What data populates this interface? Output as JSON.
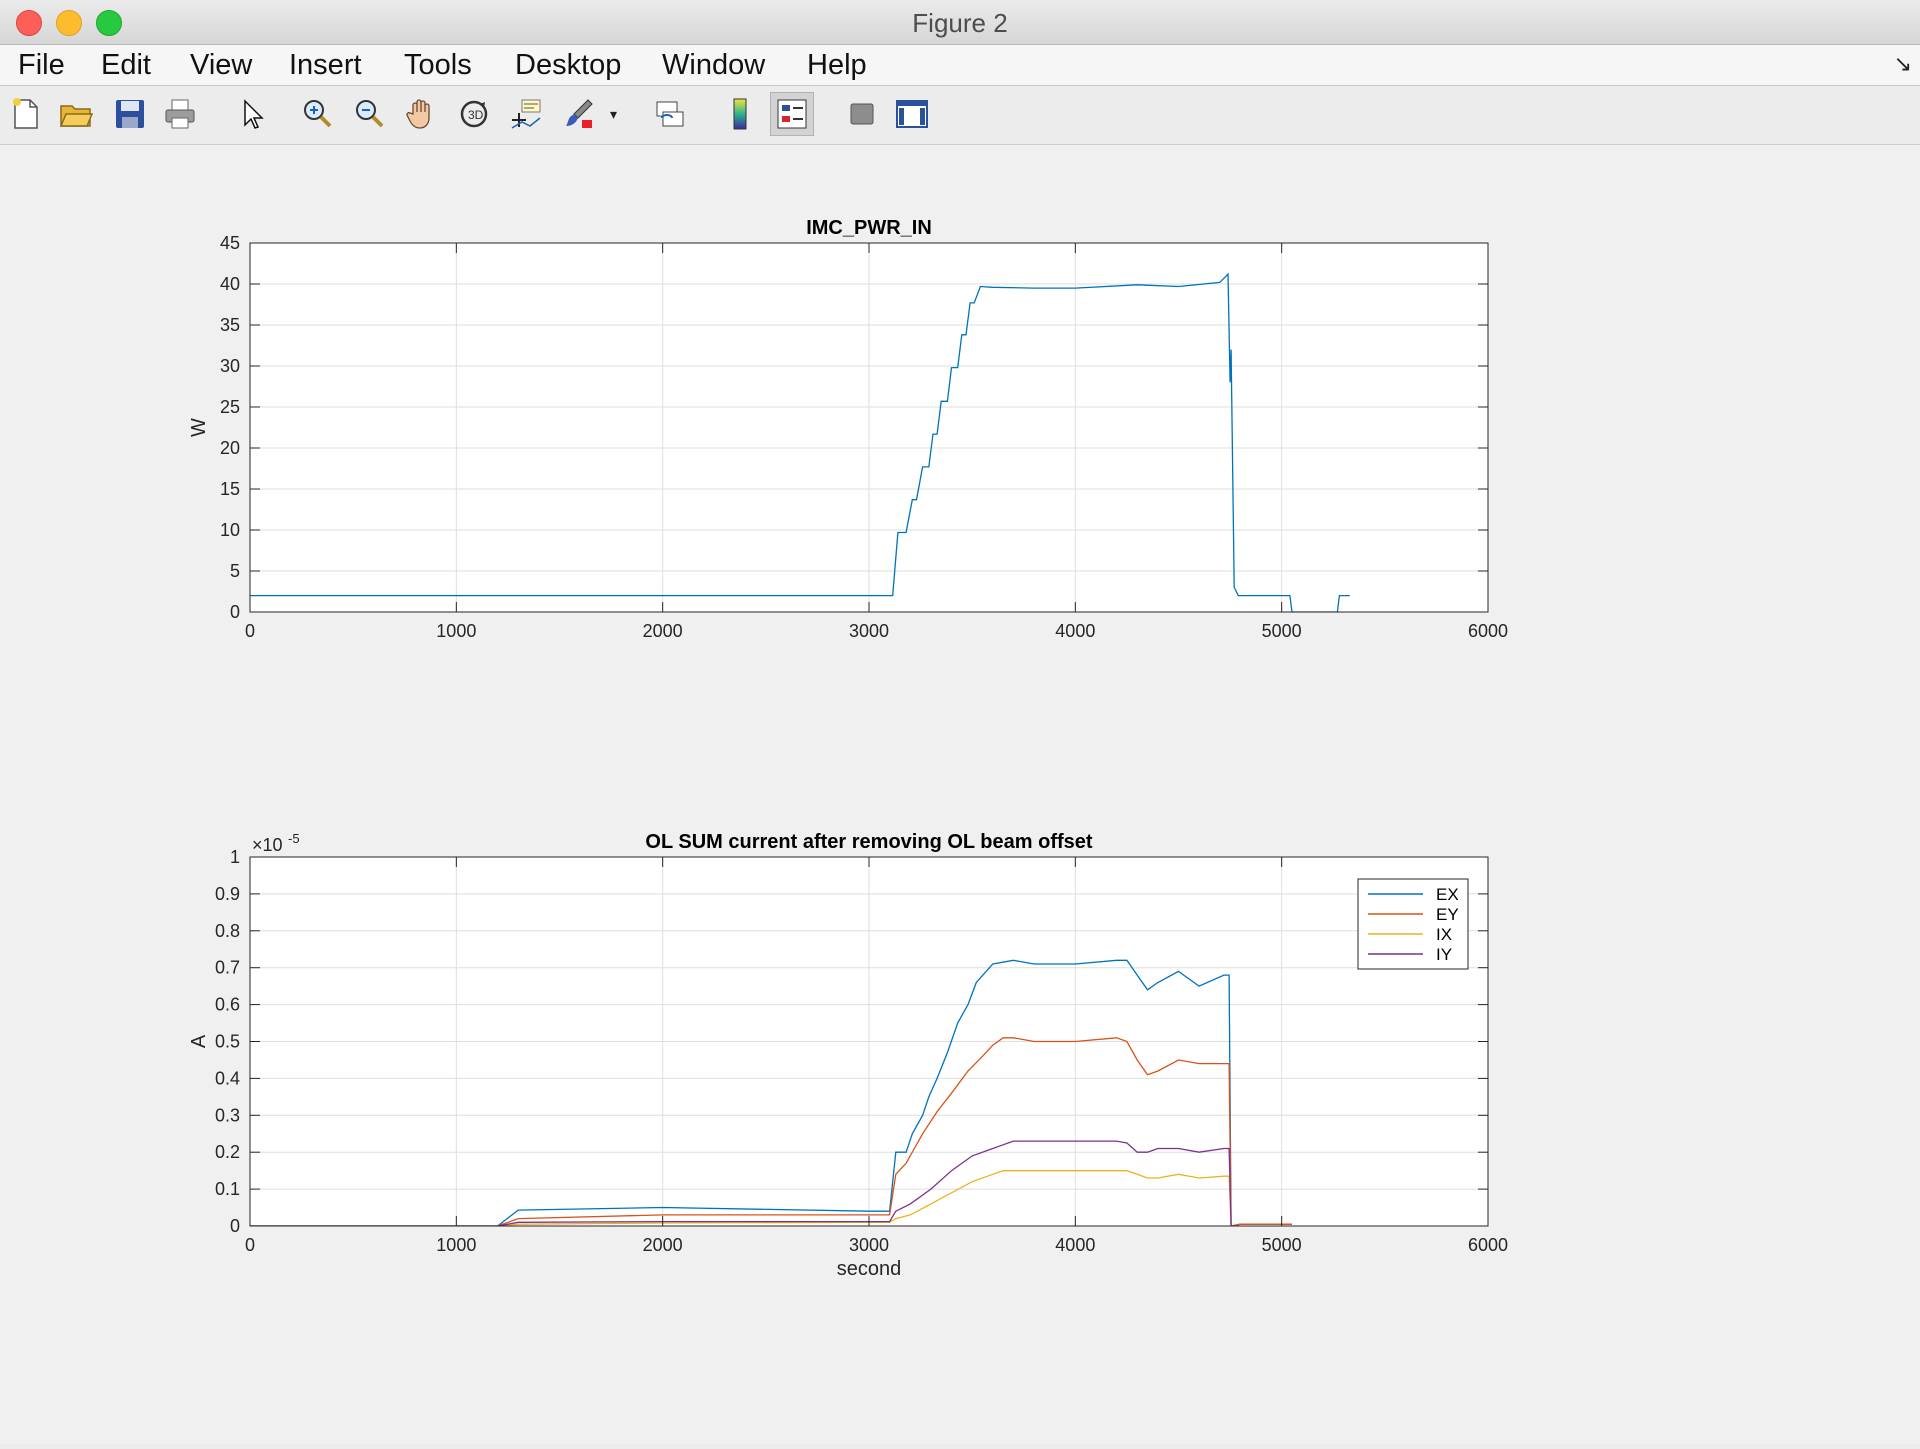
{
  "window": {
    "title": "Figure 2"
  },
  "menu": [
    "File",
    "Edit",
    "View",
    "Insert",
    "Tools",
    "Desktop",
    "Window",
    "Help"
  ],
  "toolbar_icons": [
    "new-figure-icon",
    "open-file-icon",
    "save-icon",
    "print-icon",
    "select-arrow-icon",
    "zoom-in-icon",
    "zoom-out-icon",
    "pan-hand-icon",
    "rotate-3d-icon",
    "data-cursor-icon",
    "brush-icon",
    "link-plot-icon",
    "colorbar-icon",
    "legend-icon",
    "hide-plot-tools-icon",
    "show-plot-tools-icon"
  ],
  "chart_data": [
    {
      "type": "line",
      "title": "IMC_PWR_IN",
      "xlabel": "",
      "ylabel": "W",
      "xlim": [
        0,
        6000
      ],
      "ylim": [
        0,
        45
      ],
      "xticks": [
        0,
        1000,
        2000,
        3000,
        4000,
        5000,
        6000
      ],
      "yticks": [
        0,
        5,
        10,
        15,
        20,
        25,
        30,
        35,
        40,
        45
      ],
      "grid": true,
      "series": [
        {
          "color": "#0072bd",
          "x": [
            0,
            3100,
            3115,
            3140,
            3180,
            3210,
            3230,
            3260,
            3290,
            3310,
            3330,
            3350,
            3380,
            3400,
            3430,
            3450,
            3470,
            3490,
            3510,
            3540,
            3600,
            3800,
            4000,
            4300,
            4500,
            4700,
            4740,
            4750,
            4755,
            4770,
            4790,
            4800,
            5040,
            5050,
            5270,
            5280,
            5330
          ],
          "y": [
            2,
            2,
            2,
            9.7,
            9.7,
            13.7,
            13.7,
            17.7,
            17.7,
            21.7,
            21.7,
            25.7,
            25.7,
            29.8,
            29.8,
            33.8,
            33.8,
            37.7,
            37.7,
            39.7,
            39.6,
            39.5,
            39.5,
            39.9,
            39.7,
            40.2,
            41.2,
            28,
            32,
            3,
            2,
            2,
            2,
            0,
            0,
            2,
            2
          ]
        }
      ]
    },
    {
      "type": "line",
      "title": "OL SUM current after removing OL beam offset",
      "xlabel": "second",
      "ylabel": "A",
      "exponent_label": "×10",
      "exponent_power": "-5",
      "xlim": [
        0,
        6000
      ],
      "ylim": [
        0,
        1
      ],
      "xticks": [
        0,
        1000,
        2000,
        3000,
        4000,
        5000,
        6000
      ],
      "yticks": [
        0,
        0.1,
        0.2,
        0.3,
        0.4,
        0.5,
        0.6,
        0.7,
        0.8,
        0.9,
        1
      ],
      "grid": true,
      "legend": {
        "position": "top-right"
      },
      "series": [
        {
          "name": "EX",
          "color": "#0072bd",
          "x": [
            0,
            1200,
            1300,
            2000,
            3000,
            3100,
            3130,
            3180,
            3210,
            3260,
            3290,
            3330,
            3380,
            3430,
            3480,
            3520,
            3600,
            3700,
            3800,
            4000,
            4200,
            4250,
            4300,
            4350,
            4400,
            4500,
            4600,
            4720,
            4745,
            4755,
            4800,
            5050
          ],
          "y": [
            0,
            0,
            0.043,
            0.05,
            0.04,
            0.04,
            0.2,
            0.2,
            0.25,
            0.3,
            0.35,
            0.4,
            0.47,
            0.55,
            0.6,
            0.66,
            0.71,
            0.72,
            0.71,
            0.71,
            0.72,
            0.72,
            0.68,
            0.64,
            0.66,
            0.69,
            0.65,
            0.68,
            0.68,
            0,
            0.005,
            0.005
          ]
        },
        {
          "name": "EY",
          "color": "#d95319",
          "x": [
            0,
            1200,
            1300,
            2000,
            3000,
            3100,
            3130,
            3180,
            3260,
            3330,
            3400,
            3480,
            3550,
            3600,
            3650,
            3700,
            3800,
            4000,
            4200,
            4250,
            4300,
            4350,
            4400,
            4500,
            4600,
            4720,
            4745,
            4755,
            4800,
            5050
          ],
          "y": [
            0,
            0,
            0.02,
            0.03,
            0.03,
            0.03,
            0.14,
            0.17,
            0.25,
            0.31,
            0.36,
            0.42,
            0.46,
            0.49,
            0.51,
            0.51,
            0.5,
            0.5,
            0.51,
            0.5,
            0.45,
            0.41,
            0.42,
            0.45,
            0.44,
            0.44,
            0.44,
            0,
            0.005,
            0.005
          ]
        },
        {
          "name": "IX",
          "color": "#edb120",
          "x": [
            0,
            1200,
            1300,
            2000,
            3000,
            3100,
            3130,
            3200,
            3300,
            3400,
            3500,
            3600,
            3650,
            3700,
            3800,
            4000,
            4200,
            4250,
            4300,
            4350,
            4400,
            4500,
            4600,
            4720,
            4745,
            4755
          ],
          "y": [
            0,
            0,
            0.005,
            0.008,
            0.01,
            0.01,
            0.02,
            0.03,
            0.06,
            0.09,
            0.12,
            0.14,
            0.15,
            0.15,
            0.15,
            0.15,
            0.15,
            0.15,
            0.14,
            0.13,
            0.13,
            0.14,
            0.13,
            0.135,
            0.135,
            0
          ]
        },
        {
          "name": "IY",
          "color": "#7e2f8e",
          "x": [
            0,
            1200,
            1300,
            2000,
            3000,
            3100,
            3130,
            3200,
            3300,
            3400,
            3500,
            3600,
            3650,
            3700,
            3800,
            4000,
            4200,
            4250,
            4300,
            4350,
            4400,
            4500,
            4600,
            4720,
            4745,
            4755
          ],
          "y": [
            0,
            0,
            0.01,
            0.012,
            0.012,
            0.012,
            0.04,
            0.06,
            0.1,
            0.15,
            0.19,
            0.21,
            0.22,
            0.23,
            0.23,
            0.23,
            0.23,
            0.225,
            0.2,
            0.2,
            0.21,
            0.21,
            0.2,
            0.21,
            0.21,
            0
          ]
        }
      ]
    }
  ]
}
